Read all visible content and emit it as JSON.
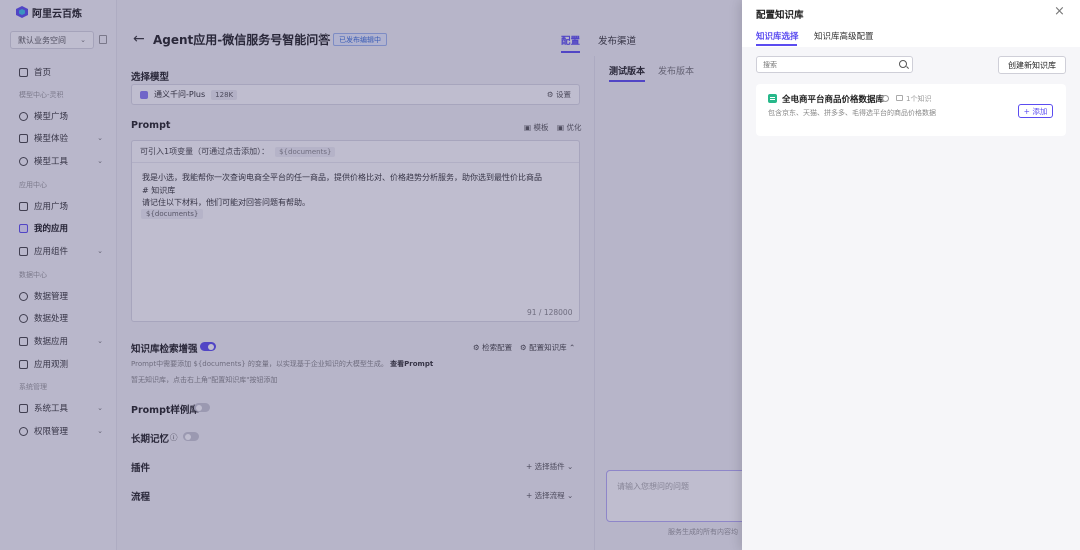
{
  "app": {
    "brand": "阿里云百炼"
  },
  "sidebar": {
    "workspace": "默认业务空间",
    "items": [
      {
        "label": "首页"
      },
      {
        "group": "模型中心-灵积"
      },
      {
        "label": "模型广场"
      },
      {
        "label": "模型体验"
      },
      {
        "label": "模型工具"
      },
      {
        "group": "应用中心"
      },
      {
        "label": "应用广场"
      },
      {
        "label": "我的应用"
      },
      {
        "label": "应用组件"
      },
      {
        "group": "数据中心"
      },
      {
        "label": "数据管理"
      },
      {
        "label": "数据处理"
      },
      {
        "label": "数据应用"
      },
      {
        "label": "应用观测"
      },
      {
        "group": "系统管理"
      },
      {
        "label": "系统工具"
      },
      {
        "label": "权限管理"
      }
    ]
  },
  "header": {
    "title": "Agent应用-微信服务号智能问答",
    "status": "已发布编辑中",
    "tabs": [
      "配置",
      "发布渠道"
    ]
  },
  "config": {
    "model_section": "选择模型",
    "model_name": "通义千问-Plus",
    "model_tag": "128K",
    "model_setting": "设置",
    "prompt_section": "Prompt",
    "prompt_template": "模板",
    "prompt_optimize": "优化",
    "var_hint": "可引入1项变量（可通过点击添加）：",
    "var_chip": "${documents}",
    "prompt_lines": [
      "我是小选，我能帮你一次查询电商全平台的任一商品，提供价格比对、价格趋势分析服务，助你选到最性价比商品",
      "# 知识库",
      "请记住以下材料，他们可能对回答问题有帮助。"
    ],
    "prompt_var": "${documents}",
    "counter": "91 / 128000",
    "kb_section": "知识库检索增强",
    "kb_search_config": "检索配置",
    "kb_config": "配置知识库",
    "kb_desc_prefix": "Prompt中需要添加",
    "kb_desc_var": "${documents}",
    "kb_desc_suffix": "的变量，以实现基于企业知识的大模型生成。",
    "kb_desc_link": "查看Prompt",
    "kb_empty": "暂无知识库，点击右上角\"配置知识库\"按钮添加",
    "prompt_examples": "Prompt样例库",
    "long_memory": "长期记忆",
    "plugins": "插件",
    "plugins_add": "选择插件",
    "flow": "流程",
    "flow_add": "选择流程"
  },
  "test": {
    "tabs": [
      "测试版本",
      "发布版本"
    ],
    "input_placeholder": "请输入您想问的问题",
    "disclaimer": "服务生成的所有内容均"
  },
  "drawer": {
    "title": "配置知识库",
    "tabs": [
      "知识库选择",
      "知识库高级配置"
    ],
    "search_placeholder": "搜索",
    "create_button": "创建新知识库",
    "kb_item": {
      "name": "全电商平台商品价格数据库",
      "count": "1个知识",
      "desc": "包含京东、天猫、拼多多、毛得选平台的商品价格数据",
      "add_button": "+ 添加"
    }
  }
}
